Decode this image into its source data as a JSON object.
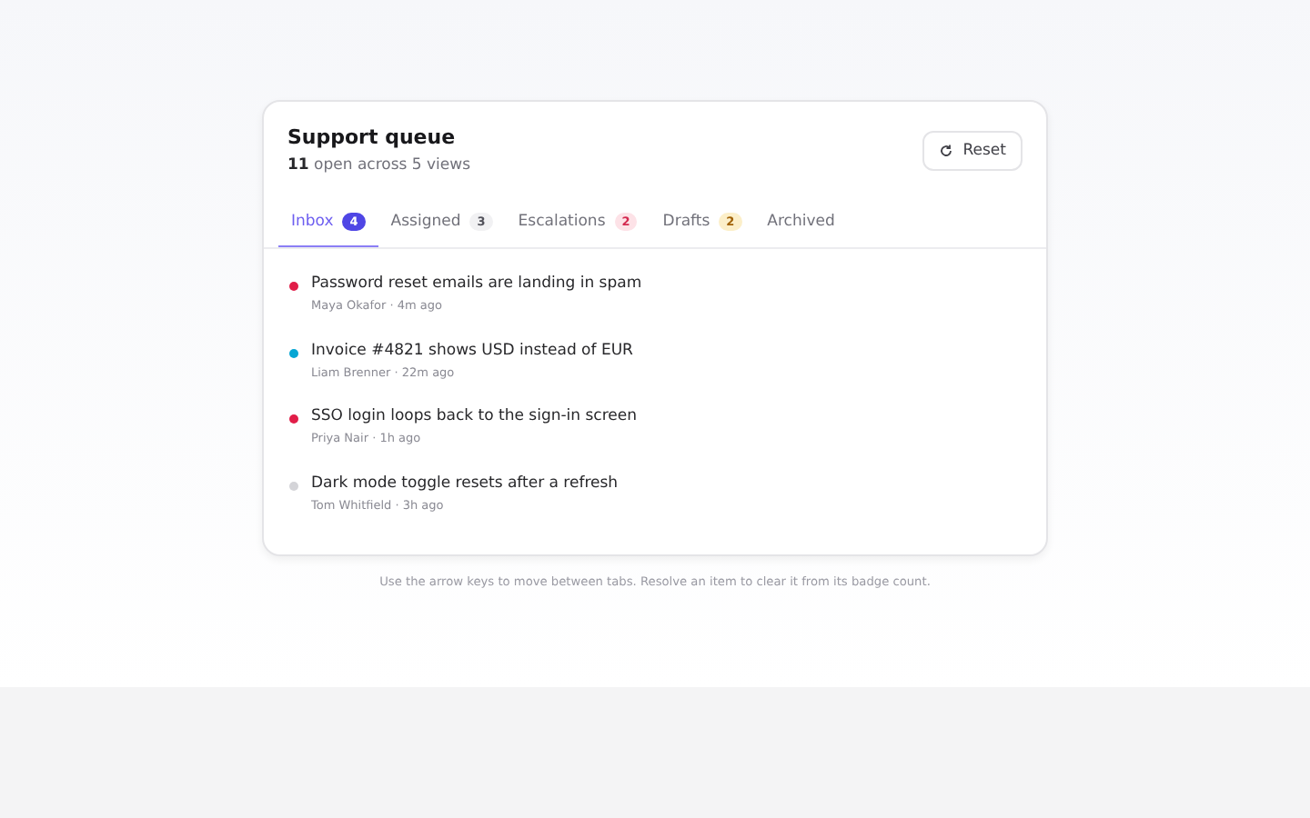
{
  "header": {
    "title": "Support queue",
    "count": "11",
    "summary": "open across 5 views",
    "reset_button": "Reset"
  },
  "tabs": [
    {
      "label": "Inbox",
      "badge": "4",
      "kind": "accent",
      "selected": true
    },
    {
      "label": "Assigned",
      "badge": "3",
      "kind": "neutral",
      "selected": false
    },
    {
      "label": "Escalations",
      "badge": "2",
      "kind": "danger",
      "selected": false
    },
    {
      "label": "Drafts",
      "badge": "2",
      "kind": "warning",
      "selected": false
    },
    {
      "label": "Archived",
      "selected": false
    }
  ],
  "items": [
    {
      "title": "Password reset emails are landing in spam",
      "meta": "Maya Okafor · 4m ago",
      "color": "#e11d48"
    },
    {
      "title": "Invoice #4821 shows USD instead of EUR",
      "meta": "Liam Brenner · 22m ago",
      "color": "#06a6d4"
    },
    {
      "title": "SSO login loops back to the sign-in screen",
      "meta": "Priya Nair · 1h ago",
      "color": "#e11d48"
    },
    {
      "title": "Dark mode toggle resets after a refresh",
      "meta": "Tom Whitfield · 3h ago",
      "color": "#d4d4d8"
    }
  ],
  "footnote": "Use the arrow keys to move between tabs. Resolve an item to clear it from its badge count."
}
